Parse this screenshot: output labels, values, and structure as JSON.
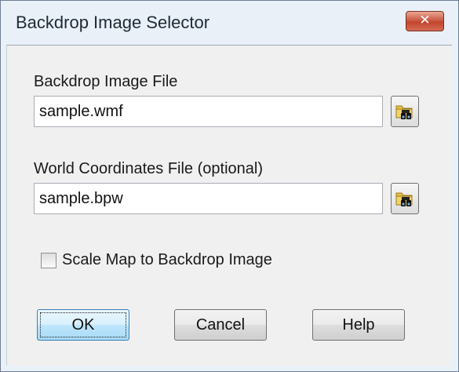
{
  "window": {
    "title": "Backdrop Image Selector",
    "close_glyph": "✕",
    "close_icon": "close-icon"
  },
  "backdrop_file": {
    "label": "Backdrop Image File",
    "value": "sample.wmf",
    "browse_icon": "folder-binoculars-icon"
  },
  "world_file": {
    "label": "World Coordinates File (optional)",
    "value": "sample.bpw",
    "browse_icon": "folder-binoculars-icon"
  },
  "scale_option": {
    "label": "Scale Map to Backdrop Image",
    "checked": false
  },
  "buttons": {
    "ok": "OK",
    "cancel": "Cancel",
    "help": "Help"
  },
  "colors": {
    "close_button": "#c2452e",
    "default_button_border": "#3c7fb1",
    "folder_icon": "#e8c24a"
  }
}
